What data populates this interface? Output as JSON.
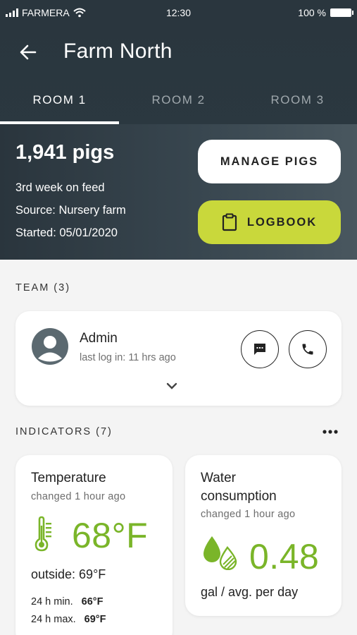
{
  "status_bar": {
    "carrier": "FARMERA",
    "time": "12:30",
    "battery": "100 %"
  },
  "header": {
    "title": "Farm North",
    "tabs": [
      {
        "label": "ROOM 1",
        "active": true
      },
      {
        "label": "ROOM 2",
        "active": false
      },
      {
        "label": "ROOM 3",
        "active": false
      }
    ]
  },
  "room": {
    "count": "1,941 pigs",
    "feed_week": "3rd week on feed",
    "source": "Source: Nursery farm",
    "started": "Started: 05/01/2020",
    "manage_label": "MANAGE PIGS",
    "logbook_label": "LOGBOOK"
  },
  "team": {
    "label": "TEAM (3)",
    "members": [
      {
        "name": "Admin",
        "last_log": "last log in: 11 hrs ago"
      }
    ]
  },
  "indicators": {
    "label": "INDICATORS (7)",
    "items": [
      {
        "title": "Temperature",
        "changed": "changed 1 hour ago",
        "value": "68°F",
        "extra": "outside: 69°F",
        "min_label": "24 h min.",
        "min_value": "66°F",
        "max_label": "24 h max.",
        "max_value": "69°F",
        "icon": "thermometer-icon"
      },
      {
        "title_line1": "Water",
        "title_line2": "consumption",
        "changed": "changed 1 hour ago",
        "value": "0.48",
        "extra": "gal / avg. per day",
        "icon": "water-drops-icon"
      }
    ]
  },
  "colors": {
    "header_bg": "#2a363e",
    "accent_green": "#7ab529",
    "logbook_button": "#c9d83b",
    "background": "#f4f4f4"
  }
}
